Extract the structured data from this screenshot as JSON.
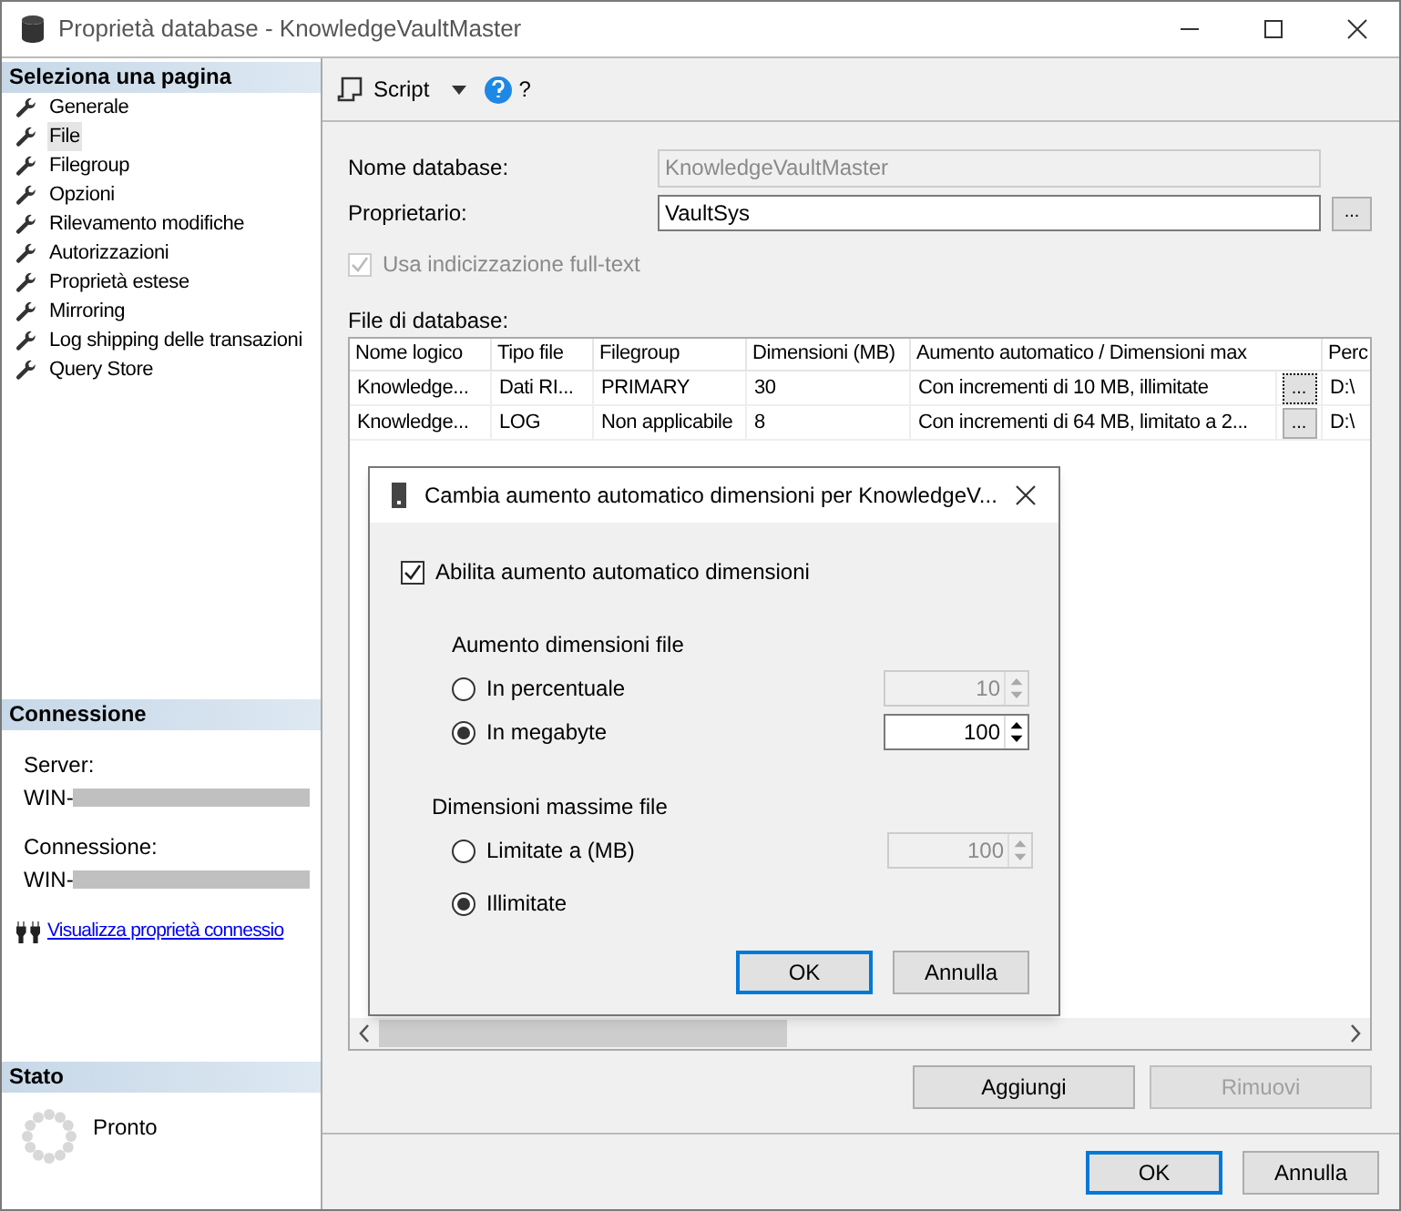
{
  "window": {
    "title": "Proprietà database - KnowledgeVaultMaster"
  },
  "sidebar": {
    "header": "Seleziona una pagina",
    "items": [
      {
        "label": "Generale",
        "selected": false
      },
      {
        "label": "File",
        "selected": true
      },
      {
        "label": "Filegroup",
        "selected": false
      },
      {
        "label": "Opzioni",
        "selected": false
      },
      {
        "label": "Rilevamento modifiche",
        "selected": false
      },
      {
        "label": "Autorizzazioni",
        "selected": false
      },
      {
        "label": "Proprietà estese",
        "selected": false
      },
      {
        "label": "Mirroring",
        "selected": false
      },
      {
        "label": "Log shipping delle transazioni",
        "selected": false
      },
      {
        "label": "Query Store",
        "selected": false
      }
    ]
  },
  "connection": {
    "header": "Connessione",
    "server_label": "Server:",
    "server_value": "WIN-",
    "connection_label": "Connessione:",
    "connection_value": "WIN-",
    "link": "Visualizza proprietà connessio"
  },
  "status": {
    "header": "Stato",
    "text": "Pronto"
  },
  "toolbar": {
    "script": "Script",
    "help": "?"
  },
  "form": {
    "name_label": "Nome database:",
    "name_value": "KnowledgeVaultMaster",
    "owner_label": "Proprietario:",
    "owner_value": "VaultSys",
    "browse": "...",
    "fulltext": {
      "label": "Usa indicizzazione full-text",
      "checked": true,
      "disabled": true
    }
  },
  "files": {
    "label": "File di database:",
    "columns": [
      "Nome logico",
      "Tipo file",
      "Filegroup",
      "Dimensioni (MB)",
      "Aumento automatico / Dimensioni max",
      "Perc"
    ],
    "rows": [
      {
        "cells": [
          "Knowledge...",
          "Dati RI...",
          "PRIMARY",
          "30",
          "Con incrementi di 10 MB, illimitate",
          "D:\\"
        ],
        "button": "...",
        "focused": true
      },
      {
        "cells": [
          "Knowledge...",
          "LOG",
          "Non applicabile",
          "8",
          "Con incrementi di 64 MB, limitato a 2...",
          "D:\\"
        ],
        "button": "...",
        "focused": false
      }
    ]
  },
  "actions": [
    {
      "label": "Aggiungi",
      "disabled": false
    },
    {
      "label": "Rimuovi",
      "disabled": true
    }
  ],
  "footer": [
    {
      "label": "OK",
      "default": true
    },
    {
      "label": "Annulla",
      "default": false
    }
  ],
  "dialog": {
    "title": "Cambia aumento automatico dimensioni per KnowledgeV...",
    "enable": {
      "label": "Abilita aumento automatico dimensioni",
      "checked": true
    },
    "groups": [
      {
        "label": "Aumento dimensioni file",
        "options": [
          {
            "label": "In percentuale",
            "selected": false,
            "value": "10",
            "disabled": true
          },
          {
            "label": "In megabyte",
            "selected": true,
            "value": "100",
            "disabled": false
          }
        ]
      },
      {
        "label": "Dimensioni massime file",
        "options": [
          {
            "label": "Limitate a (MB)",
            "selected": false,
            "value": "100",
            "disabled": true
          },
          {
            "label": "Illimitate",
            "selected": true
          }
        ]
      }
    ],
    "buttons": [
      {
        "label": "OK",
        "default": true
      },
      {
        "label": "Annulla",
        "default": false
      }
    ]
  }
}
